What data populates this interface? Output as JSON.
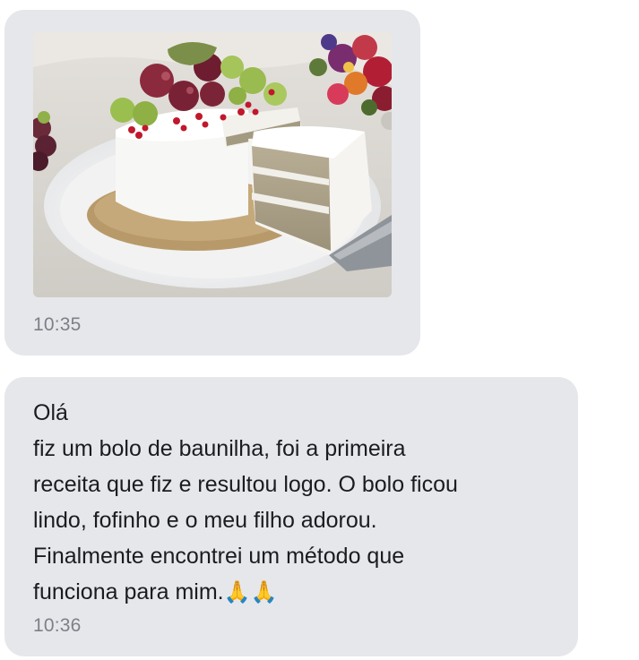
{
  "messages": [
    {
      "type": "image",
      "image_description_icon": "cake-photo",
      "time": "10:35"
    },
    {
      "type": "text",
      "lines": [
        "Olá",
        "fiz um bolo de baunilha, foi a primeira",
        "receita que fiz e resultou logo. O bolo ficou",
        "lindo, fofinho e o meu filho adorou.",
        "Finalmente encontrei um método que",
        "funciona para mim."
      ],
      "emoji": "🙏🙏",
      "time": "10:36"
    }
  ]
}
